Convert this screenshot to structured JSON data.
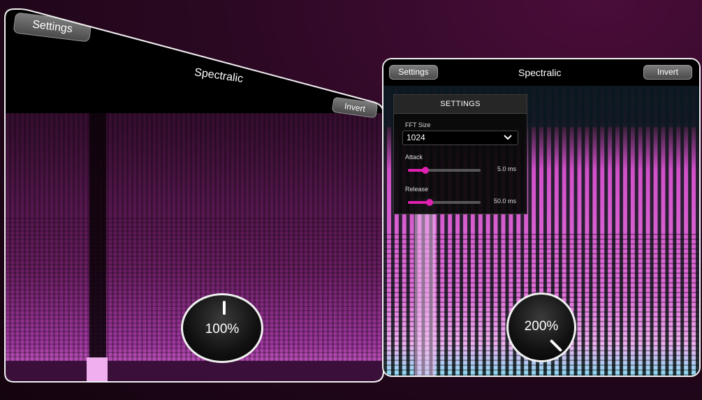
{
  "left_window": {
    "settings_label": "Settings",
    "title": "Spectralic",
    "invert_label": "Invert",
    "knob_value": "100%",
    "knob_level": 0.5
  },
  "right_window": {
    "settings_label": "Settings",
    "title": "Spectralic",
    "invert_label": "Invert",
    "knob_value": "200%",
    "knob_level": 1.0,
    "settings_panel": {
      "heading": "SETTINGS",
      "fft_label": "FFT Size",
      "fft_value": "1024",
      "attack_label": "Attack",
      "attack_value": "5.0 ms",
      "attack_level": 0.24,
      "release_label": "Release",
      "release_value": "50.0 ms",
      "release_level": 0.3
    }
  },
  "colors": {
    "accent": "#e020b0",
    "spectrum_left": "#b43aa8",
    "spectrum_right": "#e070d8",
    "spectrum_cyan": "#40a8c8"
  }
}
